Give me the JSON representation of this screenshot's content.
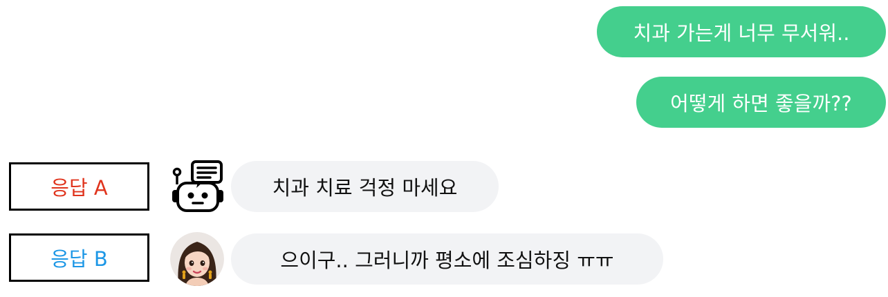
{
  "conversation": {
    "user_messages": [
      {
        "text": "치과 가는게 너무 무서워.."
      },
      {
        "text": "어떻게 하면 좋을까??"
      }
    ],
    "responses": [
      {
        "label": "응답 A",
        "avatar": "robot-chatbot-icon",
        "text": "치과 치료 걱정 마세요",
        "label_color": "#e0341d"
      },
      {
        "label": "응답 B",
        "avatar": "girl-avatar",
        "text": "으이구.. 그러니까 평소에 조심하징 ㅠㅠ",
        "label_color": "#1c97e6"
      }
    ]
  },
  "colors": {
    "user_bubble": "#44cf8d",
    "reply_bubble": "#f2f3f5"
  }
}
